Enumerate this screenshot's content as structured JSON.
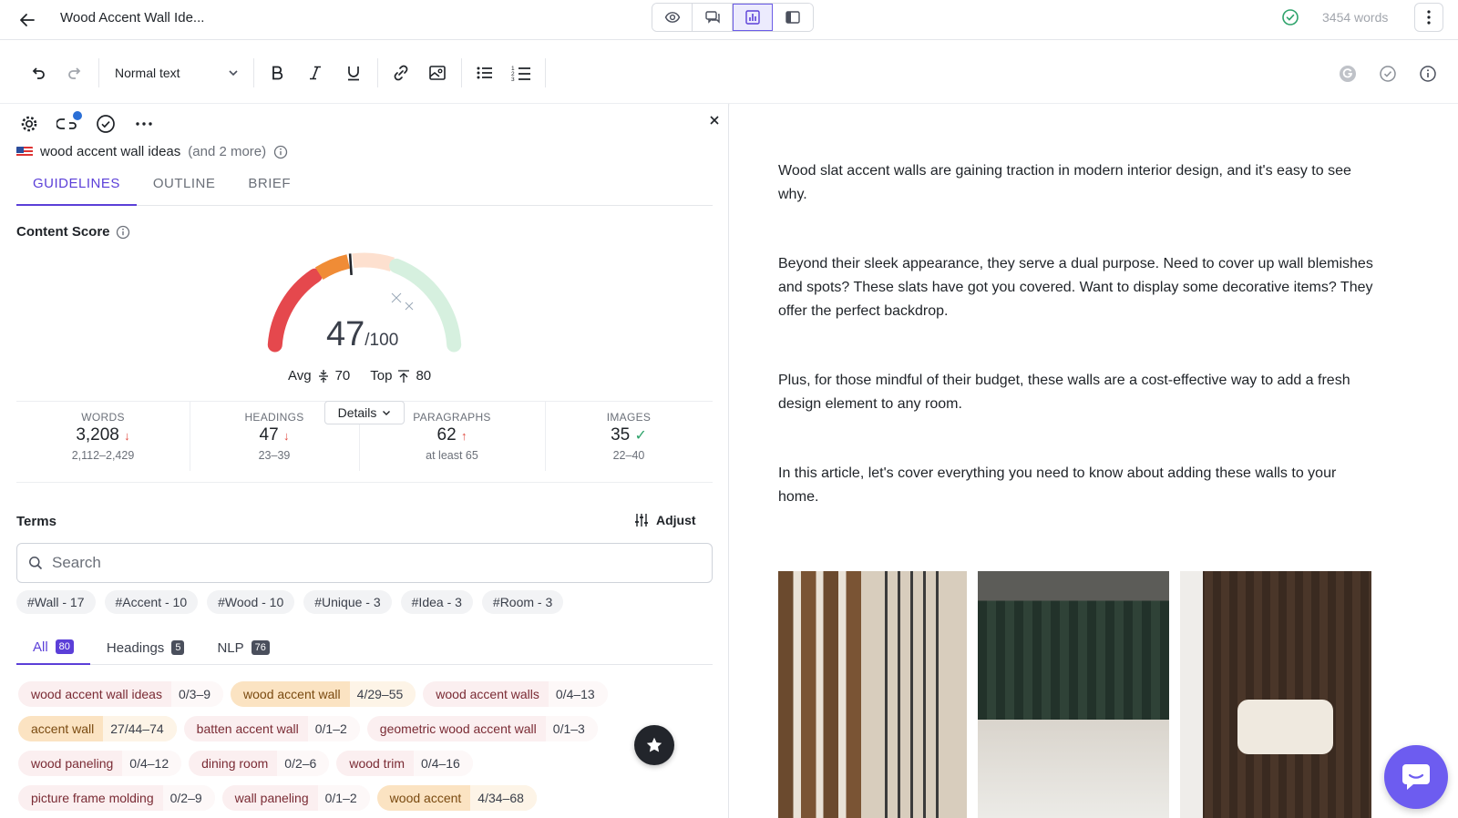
{
  "header": {
    "doc_title": "Wood Accent Wall Ide...",
    "word_count": "3454 words",
    "view_modes": [
      "preview",
      "comments",
      "optimize",
      "sidebar"
    ],
    "active_view": "optimize",
    "status": "saved"
  },
  "toolbar": {
    "text_style": "Normal text",
    "buttons": [
      "undo",
      "redo",
      "bold",
      "italic",
      "underline",
      "link",
      "image",
      "bullet-list",
      "numbered-list"
    ],
    "right_icons": [
      "grammarly",
      "check",
      "info"
    ]
  },
  "panel": {
    "keyword": "wood accent wall ideas",
    "keyword_more": "(and 2 more)",
    "tabs": [
      "GUIDELINES",
      "OUTLINE",
      "BRIEF"
    ],
    "active_tab": "GUIDELINES",
    "content_score_label": "Content Score",
    "score": {
      "value": 47,
      "value_text": "47",
      "max_text": "/100",
      "avg_label": "Avg",
      "avg_value": "70",
      "top_label": "Top",
      "top_value": "80"
    },
    "details_label": "Details",
    "stats": [
      {
        "label": "WORDS",
        "value": "3,208",
        "trend": "↓",
        "range": "2,112–2,429"
      },
      {
        "label": "HEADINGS",
        "value": "47",
        "trend": "↓",
        "range": "23–39"
      },
      {
        "label": "PARAGRAPHS",
        "value": "62",
        "trend": "↑",
        "range": "at least 65"
      },
      {
        "label": "IMAGES",
        "value": "35",
        "trend": "✓",
        "range": "22–40"
      }
    ],
    "terms_label": "Terms",
    "adjust_label": "Adjust",
    "search_placeholder": "Search",
    "topic_chips": [
      "#Wall - 17",
      "#Accent - 10",
      "#Wood - 10",
      "#Unique - 3",
      "#Idea - 3",
      "#Room - 3"
    ],
    "term_tabs": [
      {
        "label": "All",
        "count": "80"
      },
      {
        "label": "Headings",
        "count": "5"
      },
      {
        "label": "NLP",
        "count": "76"
      }
    ],
    "terms": [
      [
        {
          "name": "wood accent wall ideas",
          "count": "0/3–9",
          "hl": false
        },
        {
          "name": "wood accent wall",
          "count": "4/29–55",
          "hl": true
        },
        {
          "name": "wood accent walls",
          "count": "0/4–13",
          "hl": false
        }
      ],
      [
        {
          "name": "accent wall",
          "count": "27/44–74",
          "hl": true
        },
        {
          "name": "batten accent wall",
          "count": "0/1–2",
          "hl": false
        },
        {
          "name": "geometric wood accent wall",
          "count": "0/1–3",
          "hl": false
        }
      ],
      [
        {
          "name": "wood paneling",
          "count": "0/4–12",
          "hl": false
        },
        {
          "name": "dining room",
          "count": "0/2–6",
          "hl": false
        },
        {
          "name": "wood trim",
          "count": "0/4–16",
          "hl": false
        }
      ],
      [
        {
          "name": "picture frame molding",
          "count": "0/2–9",
          "hl": false
        },
        {
          "name": "wall paneling",
          "count": "0/1–2",
          "hl": false
        },
        {
          "name": "wood accent",
          "count": "4/34–68",
          "hl": true
        }
      ]
    ]
  },
  "editor": {
    "paragraphs": [
      "Wood slat accent walls are gaining traction in modern interior design, and it's easy to see why.",
      "Beyond their sleek appearance, they serve a dual purpose. Need to cover up wall blemishes and spots? These slats have got you covered. Want to display some decorative items? They offer the perfect backdrop.",
      "Plus, for those mindful of their budget, these walls are a cost-effective way to add a fresh design element to any room.",
      "In this article, let's cover everything you need to know about adding these walls to your home."
    ]
  },
  "colors": {
    "accent": "#5b3fd8",
    "term_default": "#fbeff0",
    "term_highlight": "#fbe3c2",
    "gauge_red": "#e5484d",
    "gauge_orange": "#f08c36",
    "gauge_peach": "#fde0cf",
    "gauge_green": "#d6f0df"
  }
}
